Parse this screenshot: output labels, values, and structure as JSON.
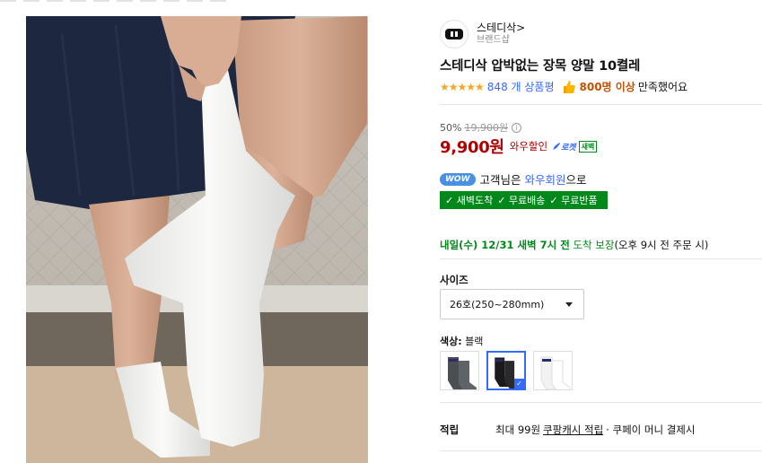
{
  "brand": {
    "name": "스테디삭",
    "chevron": ">",
    "subtitle": "브랜드샵"
  },
  "product": {
    "title": "스테디삭 압박없는 장목 양말 10켤레"
  },
  "rating": {
    "stars": "★★★★★",
    "review_count": "848 개 상품평",
    "satisfaction_count": "800명 이상",
    "satisfaction_suffix": "만족했어요"
  },
  "price": {
    "discount_rate": "50%",
    "original_price": "19,900원",
    "info_glyph": "i",
    "sale_price": "9,900원",
    "wow_label": "와우할인",
    "rocket_label": "로켓",
    "rocket_dawn": "새벽"
  },
  "wow": {
    "badge": "WOW",
    "text_prefix": "고객님은",
    "link": "와우회원",
    "text_suffix": "으로"
  },
  "benefits": [
    "✓ 새벽도착",
    "✓ 무료배송",
    "✓ 무료반품"
  ],
  "delivery": {
    "main": "내일(수) 12/31 새벽 7시 전",
    "guarantee": "도착 보장",
    "note": "(오후 9시 전 주문 시)"
  },
  "options": {
    "size_label": "사이즈",
    "size_value": "26호(250~280mm)",
    "color_label_prefix": "색상:",
    "color_value": "블랙",
    "swatches": [
      {
        "name": "그레이",
        "selected": false
      },
      {
        "name": "블랙",
        "selected": true
      },
      {
        "name": "화이트",
        "selected": false
      }
    ]
  },
  "points": {
    "label": "적립",
    "text": "최대 99원",
    "link": "쿠팡캐시 적립",
    "tail": "· 쿠페이 머니 결제시"
  },
  "colors": {
    "accent_blue": "#346aff",
    "price_red": "#ae0000",
    "delivery_green": "#00891a",
    "star_orange": "#f5a623"
  }
}
